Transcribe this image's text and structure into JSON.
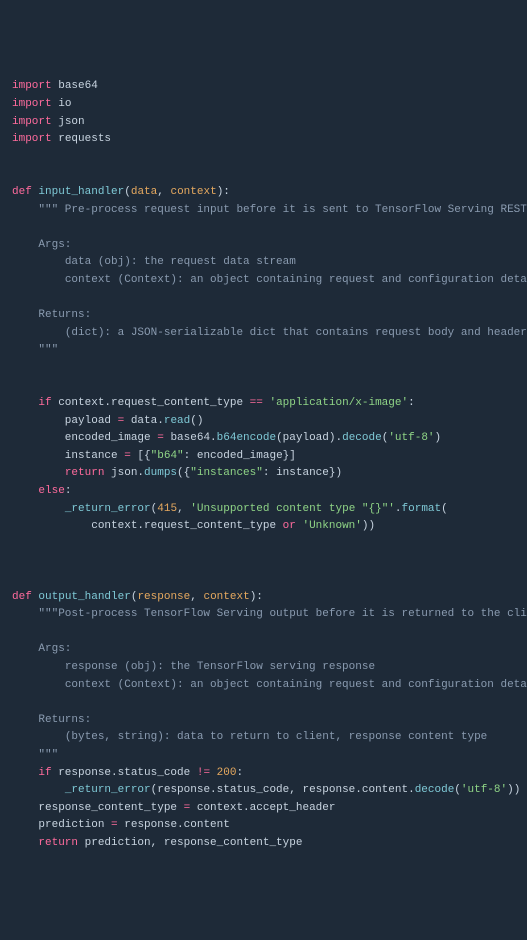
{
  "code": {
    "lines": [
      {
        "segments": [
          {
            "cls": "kw",
            "t": "import"
          },
          {
            "cls": "",
            "t": " "
          },
          {
            "cls": "mod",
            "t": "base64"
          }
        ]
      },
      {
        "segments": [
          {
            "cls": "kw",
            "t": "import"
          },
          {
            "cls": "",
            "t": " "
          },
          {
            "cls": "mod",
            "t": "io"
          }
        ]
      },
      {
        "segments": [
          {
            "cls": "kw",
            "t": "import"
          },
          {
            "cls": "",
            "t": " "
          },
          {
            "cls": "mod",
            "t": "json"
          }
        ]
      },
      {
        "segments": [
          {
            "cls": "kw",
            "t": "import"
          },
          {
            "cls": "",
            "t": " "
          },
          {
            "cls": "mod",
            "t": "requests"
          }
        ]
      },
      {
        "segments": []
      },
      {
        "segments": []
      },
      {
        "segments": [
          {
            "cls": "def",
            "t": "def"
          },
          {
            "cls": "",
            "t": " "
          },
          {
            "cls": "fn",
            "t": "input_handler"
          },
          {
            "cls": "",
            "t": "("
          },
          {
            "cls": "param",
            "t": "data"
          },
          {
            "cls": "",
            "t": ", "
          },
          {
            "cls": "param",
            "t": "context"
          },
          {
            "cls": "",
            "t": "):"
          }
        ]
      },
      {
        "segments": [
          {
            "cls": "",
            "t": "    "
          },
          {
            "cls": "doc",
            "t": "\"\"\" Pre-process request input before it is sent to TensorFlow Serving REST API"
          }
        ]
      },
      {
        "segments": []
      },
      {
        "segments": [
          {
            "cls": "",
            "t": "    "
          },
          {
            "cls": "doc",
            "t": "Args:"
          }
        ]
      },
      {
        "segments": [
          {
            "cls": "",
            "t": "        "
          },
          {
            "cls": "doc",
            "t": "data (obj): the request data stream"
          }
        ]
      },
      {
        "segments": [
          {
            "cls": "",
            "t": "        "
          },
          {
            "cls": "doc",
            "t": "context (Context): an object containing request and configuration details"
          }
        ]
      },
      {
        "segments": []
      },
      {
        "segments": [
          {
            "cls": "",
            "t": "    "
          },
          {
            "cls": "doc",
            "t": "Returns:"
          }
        ]
      },
      {
        "segments": [
          {
            "cls": "",
            "t": "        "
          },
          {
            "cls": "doc",
            "t": "(dict): a JSON-serializable dict that contains request body and headers"
          }
        ]
      },
      {
        "segments": [
          {
            "cls": "",
            "t": "    "
          },
          {
            "cls": "doc",
            "t": "\"\"\""
          }
        ]
      },
      {
        "segments": []
      },
      {
        "segments": []
      },
      {
        "segments": [
          {
            "cls": "",
            "t": "    "
          },
          {
            "cls": "kw",
            "t": "if"
          },
          {
            "cls": "",
            "t": " context.request_content_type "
          },
          {
            "cls": "op",
            "t": "=="
          },
          {
            "cls": "",
            "t": " "
          },
          {
            "cls": "str",
            "t": "'application/x-image'"
          },
          {
            "cls": "",
            "t": ":"
          }
        ]
      },
      {
        "segments": [
          {
            "cls": "",
            "t": "        payload "
          },
          {
            "cls": "op",
            "t": "="
          },
          {
            "cls": "",
            "t": " data."
          },
          {
            "cls": "fn",
            "t": "read"
          },
          {
            "cls": "",
            "t": "()"
          }
        ]
      },
      {
        "segments": [
          {
            "cls": "",
            "t": "        encoded_image "
          },
          {
            "cls": "op",
            "t": "="
          },
          {
            "cls": "",
            "t": " base64."
          },
          {
            "cls": "fn",
            "t": "b64encode"
          },
          {
            "cls": "",
            "t": "(payload)."
          },
          {
            "cls": "fn",
            "t": "decode"
          },
          {
            "cls": "",
            "t": "("
          },
          {
            "cls": "str",
            "t": "'utf-8'"
          },
          {
            "cls": "",
            "t": ")"
          }
        ]
      },
      {
        "segments": [
          {
            "cls": "",
            "t": "        instance "
          },
          {
            "cls": "op",
            "t": "="
          },
          {
            "cls": "",
            "t": " [{"
          },
          {
            "cls": "str",
            "t": "\"b64\""
          },
          {
            "cls": "",
            "t": ": encoded_image}]"
          }
        ]
      },
      {
        "segments": [
          {
            "cls": "",
            "t": "        "
          },
          {
            "cls": "kw",
            "t": "return"
          },
          {
            "cls": "",
            "t": " json."
          },
          {
            "cls": "fn",
            "t": "dumps"
          },
          {
            "cls": "",
            "t": "({"
          },
          {
            "cls": "str",
            "t": "\"instances\""
          },
          {
            "cls": "",
            "t": ": instance})"
          }
        ]
      },
      {
        "segments": [
          {
            "cls": "",
            "t": "    "
          },
          {
            "cls": "kw",
            "t": "else"
          },
          {
            "cls": "",
            "t": ":"
          }
        ]
      },
      {
        "segments": [
          {
            "cls": "",
            "t": "        "
          },
          {
            "cls": "fn",
            "t": "_return_error"
          },
          {
            "cls": "",
            "t": "("
          },
          {
            "cls": "num",
            "t": "415"
          },
          {
            "cls": "",
            "t": ", "
          },
          {
            "cls": "str",
            "t": "'Unsupported content type \"{}\"'"
          },
          {
            "cls": "",
            "t": "."
          },
          {
            "cls": "fn",
            "t": "format"
          },
          {
            "cls": "",
            "t": "("
          }
        ]
      },
      {
        "segments": [
          {
            "cls": "",
            "t": "            context.request_content_type "
          },
          {
            "cls": "kw",
            "t": "or"
          },
          {
            "cls": "",
            "t": " "
          },
          {
            "cls": "str",
            "t": "'Unknown'"
          },
          {
            "cls": "",
            "t": "))"
          }
        ]
      },
      {
        "segments": []
      },
      {
        "segments": []
      },
      {
        "segments": []
      },
      {
        "segments": [
          {
            "cls": "def",
            "t": "def"
          },
          {
            "cls": "",
            "t": " "
          },
          {
            "cls": "fn",
            "t": "output_handler"
          },
          {
            "cls": "",
            "t": "("
          },
          {
            "cls": "param",
            "t": "response"
          },
          {
            "cls": "",
            "t": ", "
          },
          {
            "cls": "param",
            "t": "context"
          },
          {
            "cls": "",
            "t": "):"
          }
        ]
      },
      {
        "segments": [
          {
            "cls": "",
            "t": "    "
          },
          {
            "cls": "doc",
            "t": "\"\"\"Post-process TensorFlow Serving output before it is returned to the client."
          }
        ]
      },
      {
        "segments": []
      },
      {
        "segments": [
          {
            "cls": "",
            "t": "    "
          },
          {
            "cls": "doc",
            "t": "Args:"
          }
        ]
      },
      {
        "segments": [
          {
            "cls": "",
            "t": "        "
          },
          {
            "cls": "doc",
            "t": "response (obj): the TensorFlow serving response"
          }
        ]
      },
      {
        "segments": [
          {
            "cls": "",
            "t": "        "
          },
          {
            "cls": "doc",
            "t": "context (Context): an object containing request and configuration details"
          }
        ]
      },
      {
        "segments": []
      },
      {
        "segments": [
          {
            "cls": "",
            "t": "    "
          },
          {
            "cls": "doc",
            "t": "Returns:"
          }
        ]
      },
      {
        "segments": [
          {
            "cls": "",
            "t": "        "
          },
          {
            "cls": "doc",
            "t": "(bytes, string): data to return to client, response content type"
          }
        ]
      },
      {
        "segments": [
          {
            "cls": "",
            "t": "    "
          },
          {
            "cls": "doc",
            "t": "\"\"\""
          }
        ]
      },
      {
        "segments": [
          {
            "cls": "",
            "t": "    "
          },
          {
            "cls": "kw",
            "t": "if"
          },
          {
            "cls": "",
            "t": " response.status_code "
          },
          {
            "cls": "op",
            "t": "!="
          },
          {
            "cls": "",
            "t": " "
          },
          {
            "cls": "num",
            "t": "200"
          },
          {
            "cls": "",
            "t": ":"
          }
        ]
      },
      {
        "segments": [
          {
            "cls": "",
            "t": "        "
          },
          {
            "cls": "fn",
            "t": "_return_error"
          },
          {
            "cls": "",
            "t": "(response.status_code, response.content."
          },
          {
            "cls": "fn",
            "t": "decode"
          },
          {
            "cls": "",
            "t": "("
          },
          {
            "cls": "str",
            "t": "'utf-8'"
          },
          {
            "cls": "",
            "t": "))"
          }
        ]
      },
      {
        "segments": [
          {
            "cls": "",
            "t": "    response_content_type "
          },
          {
            "cls": "op",
            "t": "="
          },
          {
            "cls": "",
            "t": " context.accept_header"
          }
        ]
      },
      {
        "segments": [
          {
            "cls": "",
            "t": "    prediction "
          },
          {
            "cls": "op",
            "t": "="
          },
          {
            "cls": "",
            "t": " response.content"
          }
        ]
      },
      {
        "segments": [
          {
            "cls": "",
            "t": "    "
          },
          {
            "cls": "kw",
            "t": "return"
          },
          {
            "cls": "",
            "t": " prediction, response_content_type"
          }
        ]
      }
    ]
  }
}
